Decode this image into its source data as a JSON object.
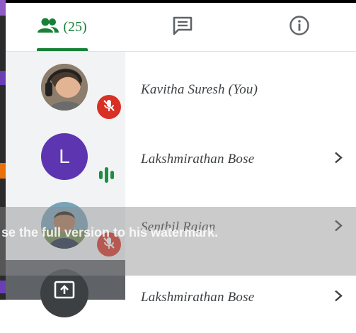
{
  "tabs": {
    "people_count": "(25)",
    "people_icon": "people-icon",
    "chat_icon": "chat-icon",
    "info_icon": "info-icon"
  },
  "participants": [
    {
      "name": "Kavitha Suresh (You)",
      "status": "muted"
    },
    {
      "name": "Lakshmirathan Bose",
      "avatar_letter": "L",
      "status": "speaking"
    },
    {
      "name": "Senthil Rajan",
      "status": "muted"
    },
    {
      "name": "Lakshmirathan Bose",
      "status": "presenting"
    }
  ],
  "watermark": "se the full version to     his watermark.",
  "colors": {
    "accent": "#188038",
    "mute_red": "#d93025",
    "avatar_purple": "#5e35b1"
  }
}
